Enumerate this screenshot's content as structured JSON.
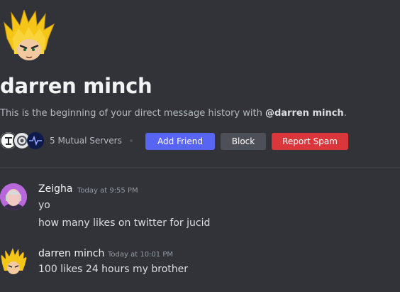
{
  "dm": {
    "username": "darren minch",
    "intro_prefix": "This is the beginning of your direct message history with ",
    "intro_user": "@darren minch",
    "intro_suffix": ".",
    "mutual_servers": "5 Mutual Servers",
    "actions": {
      "add_friend": "Add Friend",
      "block": "Block",
      "report_spam": "Report Spam"
    }
  },
  "messages": [
    {
      "author": "Zeigha",
      "timestamp": "Today at 9:55 PM",
      "lines": [
        "yo",
        "how many likes on twitter for jucid"
      ]
    },
    {
      "author": "darren minch",
      "timestamp": "Today at 10:01 PM",
      "lines": [
        "100 likes 24 hours my brother"
      ]
    }
  ],
  "colors": {
    "background": "#313338",
    "add_friend": "#5865f2",
    "block": "#4e5058",
    "report": "#da373c"
  }
}
